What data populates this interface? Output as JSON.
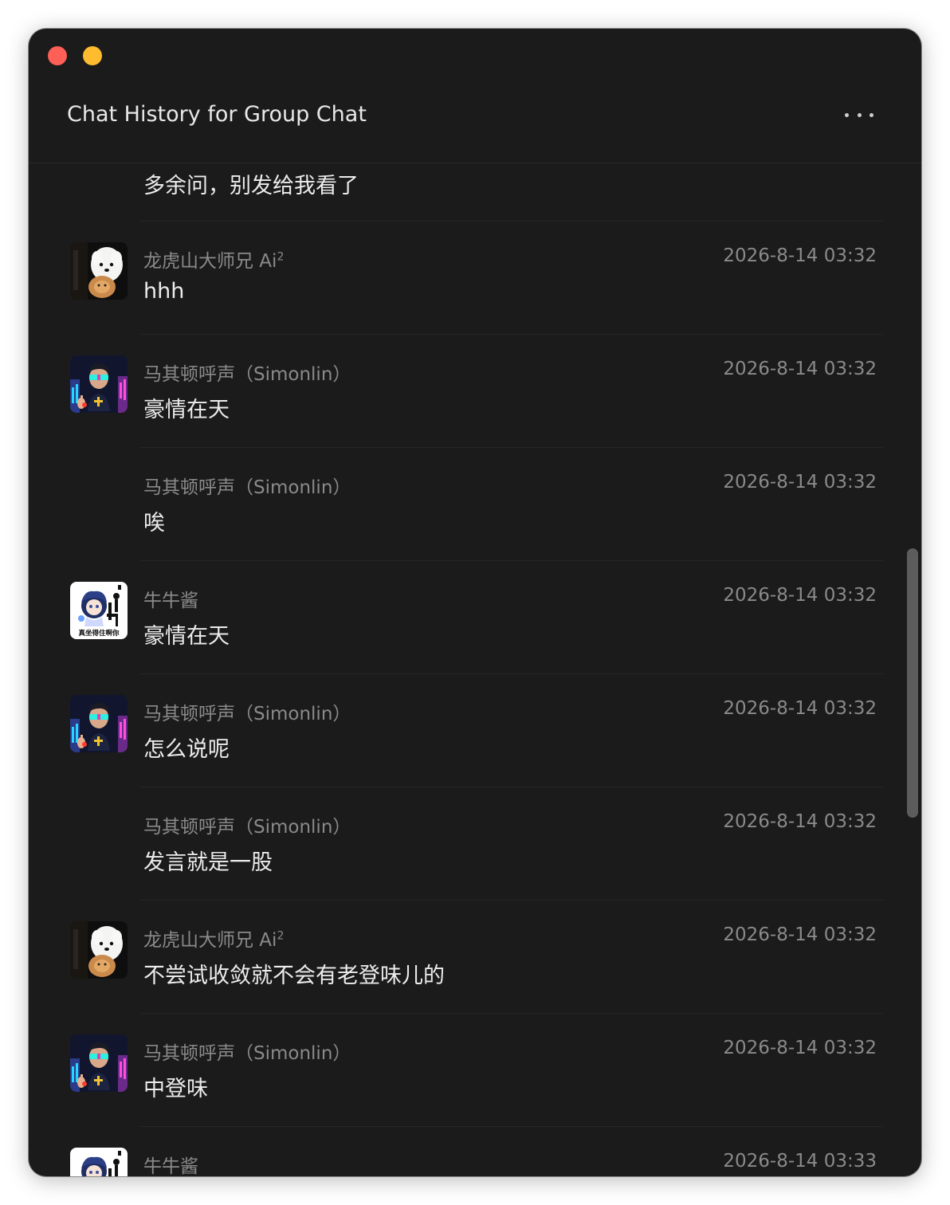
{
  "window": {
    "title": "Chat History for Group Chat",
    "more_icon": "more-horizontal-icon"
  },
  "partial_message": "多余问，别发给我看了",
  "messages": [
    {
      "sender": "龙虎山大师兄 Ai",
      "sup": "2",
      "time": "2026-8-14 03:32",
      "text": "hhh",
      "avatar": "samoyed-dog-cat-avatar"
    },
    {
      "sender": "马其顿呼声（Simonlin）",
      "sup": "",
      "time": "2026-8-14 03:32",
      "text": "豪情在天",
      "avatar": "cyber-man-sunglasses-avatar"
    },
    {
      "sender": "马其顿呼声（Simonlin）",
      "sup": "",
      "time": "2026-8-14 03:32",
      "text": "唉",
      "avatar": ""
    },
    {
      "sender": "牛牛酱",
      "sup": "",
      "time": "2026-8-14 03:32",
      "text": "豪情在天",
      "avatar": "anime-girl-sticker-avatar",
      "avatar_caption": "真坐得住啊你"
    },
    {
      "sender": "马其顿呼声（Simonlin）",
      "sup": "",
      "time": "2026-8-14 03:32",
      "text": "怎么说呢",
      "avatar": "cyber-man-sunglasses-avatar"
    },
    {
      "sender": "马其顿呼声（Simonlin）",
      "sup": "",
      "time": "2026-8-14 03:32",
      "text": "发言就是一股",
      "avatar": ""
    },
    {
      "sender": "龙虎山大师兄 Ai",
      "sup": "2",
      "time": "2026-8-14 03:32",
      "text": "不尝试收敛就不会有老登味儿的",
      "avatar": "samoyed-dog-cat-avatar"
    },
    {
      "sender": "马其顿呼声（Simonlin）",
      "sup": "",
      "time": "2026-8-14 03:32",
      "text": "中登味",
      "avatar": "cyber-man-sunglasses-avatar"
    },
    {
      "sender": "牛牛酱",
      "sup": "",
      "time": "2026-8-14 03:33",
      "text": "",
      "avatar": "anime-girl-sticker-avatar",
      "avatar_caption": "真坐得住啊你"
    }
  ]
}
